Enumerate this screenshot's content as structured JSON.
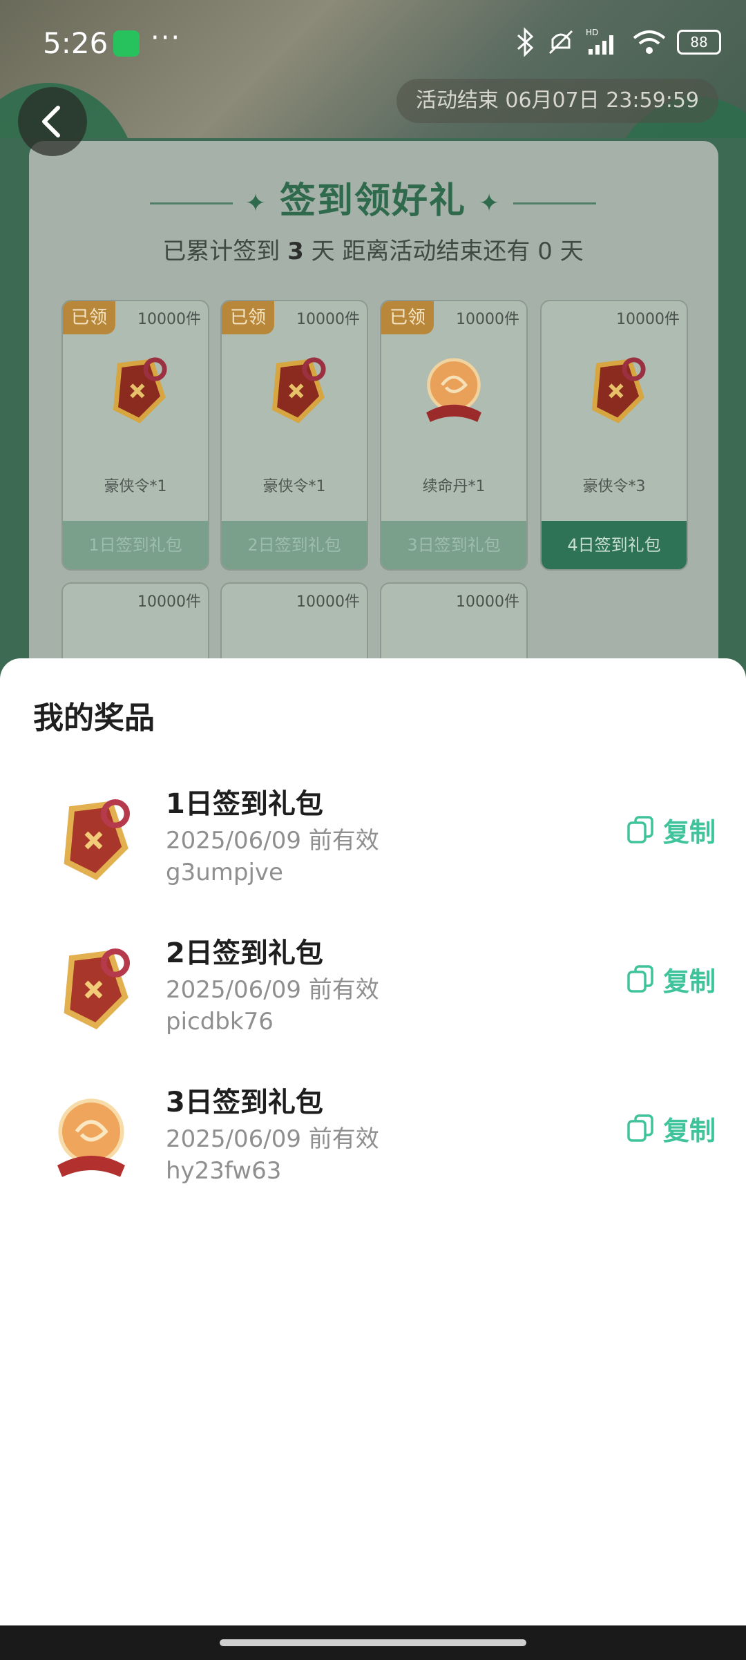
{
  "status_bar": {
    "time": "5:26",
    "more": "···",
    "battery": "88",
    "icons": [
      "wechat-icon",
      "bluetooth-icon",
      "mute-icon",
      "signal-icon",
      "wifi-icon",
      "battery-icon"
    ]
  },
  "activity": {
    "end_time": "活动结束 06月07日 23:59:59",
    "title": "签到领好礼",
    "summary_prefix": "已累计签到",
    "summary_days": "3",
    "summary_mid": "天  距离活动结束还有",
    "summary_left": "0",
    "summary_suffix": "天",
    "gifts": [
      {
        "tag": "已领",
        "count": "10000件",
        "item": "豪侠令*1",
        "button": "1日签到礼包",
        "icon": "token-icon"
      },
      {
        "tag": "已领",
        "count": "10000件",
        "item": "豪侠令*1",
        "button": "2日签到礼包",
        "icon": "token-icon"
      },
      {
        "tag": "已领",
        "count": "10000件",
        "item": "续命丹*1",
        "button": "3日签到礼包",
        "icon": "orb-icon"
      },
      {
        "tag": "",
        "count": "10000件",
        "item": "豪侠令*3",
        "button": "4日签到礼包",
        "icon": "token-icon"
      },
      {
        "count": "10000件"
      },
      {
        "count": "10000件"
      },
      {
        "count": "10000件"
      }
    ]
  },
  "sheet": {
    "title": "我的奖品",
    "prizes": [
      {
        "name": "1日签到礼包",
        "valid": "2025/06/09 前有效",
        "code": "g3umpjve",
        "copy": "复制",
        "icon": "token-icon"
      },
      {
        "name": "2日签到礼包",
        "valid": "2025/06/09 前有效",
        "code": "picdbk76",
        "copy": "复制",
        "icon": "token-icon"
      },
      {
        "name": "3日签到礼包",
        "valid": "2025/06/09 前有效",
        "code": "hy23fw63",
        "copy": "复制",
        "icon": "orb-icon"
      }
    ]
  },
  "colors": {
    "accent": "#3fc39a",
    "panel_green": "#2f7356",
    "claimed_tag": "#b9873a"
  }
}
